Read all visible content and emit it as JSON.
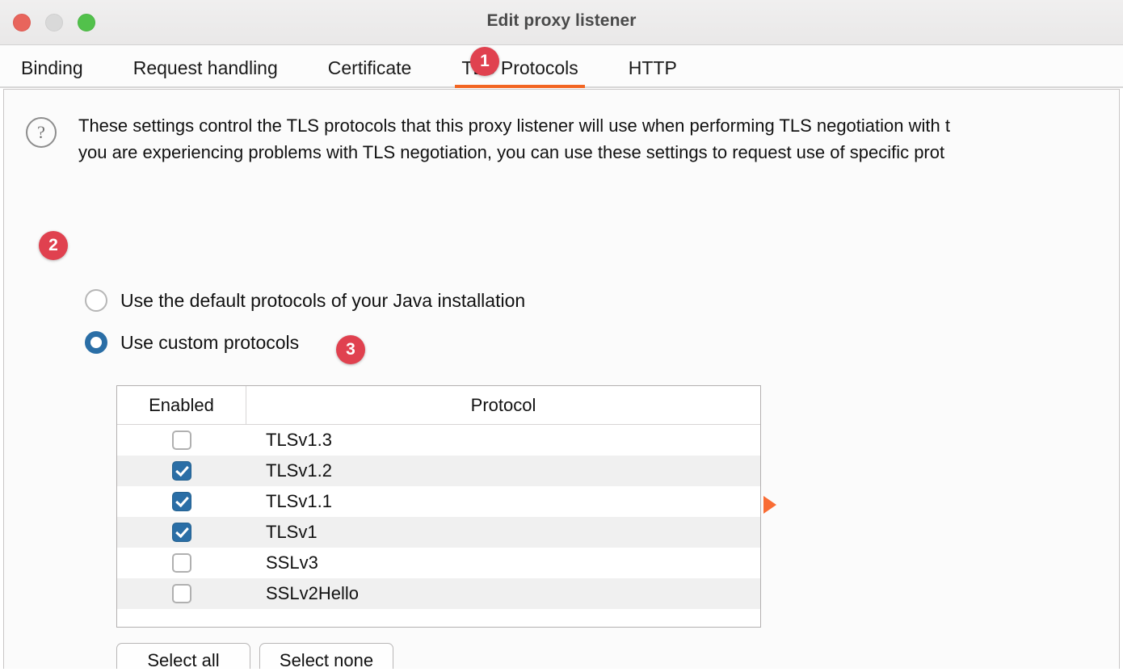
{
  "window": {
    "title": "Edit proxy listener",
    "traffic_lights": [
      {
        "name": "close",
        "color": "#e8655c"
      },
      {
        "name": "minimize",
        "color": "#d9d9d9"
      },
      {
        "name": "maximize",
        "color": "#52c14b"
      }
    ]
  },
  "tabs": [
    {
      "label": "Binding",
      "active": false
    },
    {
      "label": "Request handling",
      "active": false
    },
    {
      "label": "Certificate",
      "active": false
    },
    {
      "label": "TLS Protocols",
      "active": true
    },
    {
      "label": "HTTP",
      "active": false
    }
  ],
  "description": {
    "icon": "help-circle-icon",
    "line1": "These settings control the TLS protocols that this proxy listener will use when performing TLS negotiation with t",
    "line2": "you are experiencing problems with TLS negotiation, you can use these settings to request use of specific prot"
  },
  "radio_group": {
    "options": [
      {
        "label": "Use the default protocols of your Java installation",
        "selected": false
      },
      {
        "label": "Use custom protocols",
        "selected": true
      }
    ]
  },
  "table": {
    "headers": [
      "Enabled",
      "Protocol"
    ],
    "rows": [
      {
        "protocol": "TLSv1.3",
        "enabled": false
      },
      {
        "protocol": "TLSv1.2",
        "enabled": true
      },
      {
        "protocol": "TLSv1.1",
        "enabled": true
      },
      {
        "protocol": "TLSv1",
        "enabled": true
      },
      {
        "protocol": "SSLv3",
        "enabled": false
      },
      {
        "protocol": "SSLv2Hello",
        "enabled": false
      }
    ]
  },
  "buttons": {
    "select_all": "Select all",
    "select_none": "Select none"
  },
  "annotations": [
    {
      "number": "1",
      "target": "tls-protocols-tab"
    },
    {
      "number": "2",
      "target": "use-custom-protocols-radio"
    },
    {
      "number": "3",
      "target": "tlsv13-row"
    }
  ],
  "colors": {
    "accent_orange": "#f26522",
    "badge_red": "#e0414f",
    "control_blue": "#2a6ea6",
    "cursor_orange": "#f96c34"
  }
}
